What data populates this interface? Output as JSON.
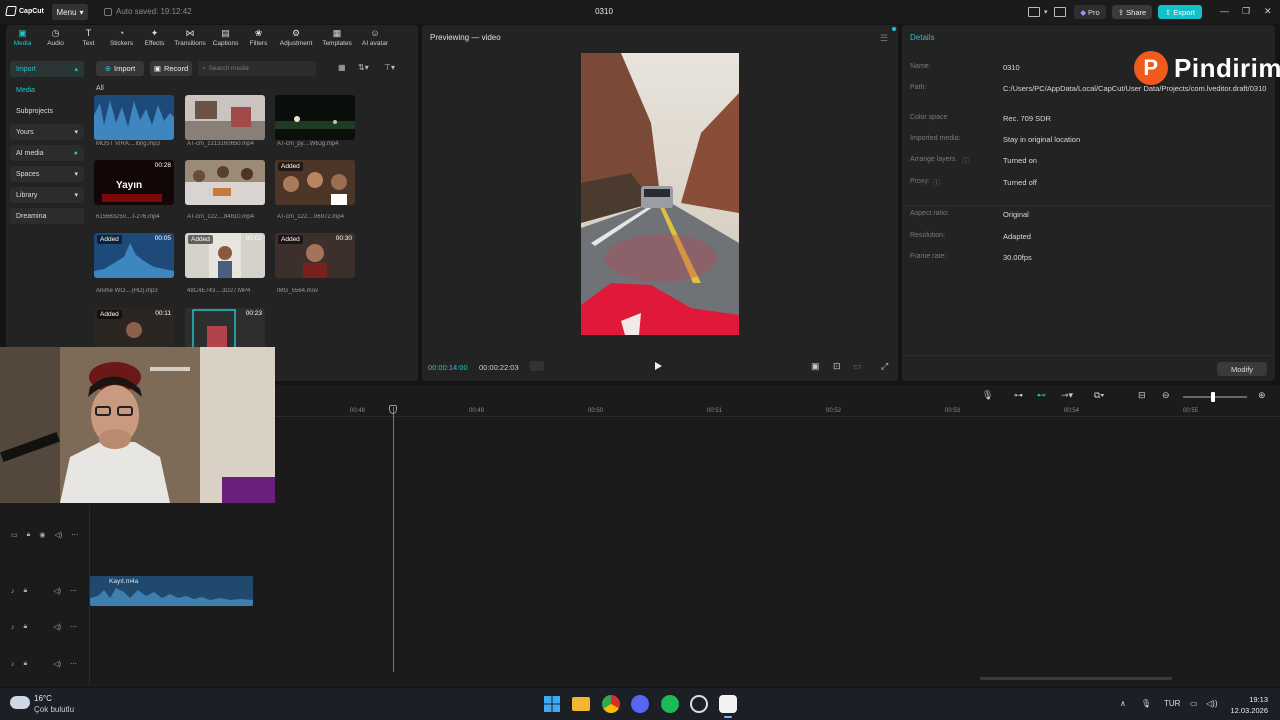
{
  "titlebar": {
    "app_name": "CapCut",
    "menu_label": "Menu",
    "autosave": "Auto saved: 19:12:42",
    "project_title": "0310",
    "pro_label": "Pro",
    "share_label": "Share",
    "export_label": "Export"
  },
  "toolbar": {
    "items": [
      {
        "label": "Media",
        "icon": "media-icon"
      },
      {
        "label": "Audio",
        "icon": "audio-icon"
      },
      {
        "label": "Text",
        "icon": "text-icon"
      },
      {
        "label": "Stickers",
        "icon": "stickers-icon"
      },
      {
        "label": "Effects",
        "icon": "effects-icon"
      },
      {
        "label": "Transitions",
        "icon": "transitions-icon"
      },
      {
        "label": "Captions",
        "icon": "captions-icon"
      },
      {
        "label": "Filters",
        "icon": "filters-icon"
      },
      {
        "label": "Adjustment",
        "icon": "adjustment-icon"
      },
      {
        "label": "Templates",
        "icon": "templates-icon"
      },
      {
        "label": "AI avatar",
        "icon": "ai-avatar-icon"
      }
    ]
  },
  "sidebar": {
    "items": [
      {
        "label": "Import"
      },
      {
        "label": "Media"
      },
      {
        "label": "Subprojects"
      },
      {
        "label": "Yours"
      },
      {
        "label": "AI media"
      },
      {
        "label": "Spaces"
      },
      {
        "label": "Library"
      },
      {
        "label": "Dreamina"
      }
    ]
  },
  "media": {
    "import_label": "Import",
    "record_label": "Record",
    "search_placeholder": "Search media",
    "filter_all": "All",
    "items": [
      {
        "name": "MOST VIRA....iting.mp3",
        "badge": "",
        "duration": ""
      },
      {
        "name": "AT-cm_1213160650.mp4",
        "badge": "",
        "duration": ""
      },
      {
        "name": "AT-cm_py....W6Jg.mp4",
        "badge": "",
        "duration": ""
      },
      {
        "name": "615663250....t-276.mp4",
        "badge": "",
        "duration": "00:28"
      },
      {
        "name": "AT-cm_122....84610.mp4",
        "badge": "",
        "duration": ""
      },
      {
        "name": "AT-cm_122....06972.mp4",
        "badge": "Added",
        "duration": ""
      },
      {
        "name": "Anime WO....(HD).mp3",
        "badge": "Added",
        "duration": "00:05"
      },
      {
        "name": "48C4E743....3D27.MP4",
        "badge": "Added",
        "duration": "00:02"
      },
      {
        "name": "IMG_5564.mov",
        "badge": "Added",
        "duration": "00:30"
      },
      {
        "name": "",
        "badge": "Added",
        "duration": "00:11"
      },
      {
        "name": "",
        "badge": "",
        "duration": "00:23"
      }
    ],
    "thumb_text": "Yayın"
  },
  "preview": {
    "title": "Previewing — video",
    "current_time": "00:00:14:00",
    "total_time": "00:00:22:03"
  },
  "details": {
    "title": "Details",
    "rows": [
      {
        "label": "Name:",
        "value": "0310"
      },
      {
        "label": "Path:",
        "value": "C:/Users/PC/AppData/Local/CapCut/User Data/Projects/com.lveditor.draft/0310"
      },
      {
        "label": "Color space",
        "value": "Rec. 709 SDR"
      },
      {
        "label": "Imported media:",
        "value": "Stay in original location"
      },
      {
        "label": "Arrange layers",
        "value": "Turned on"
      },
      {
        "label": "Proxy:",
        "value": "Turned off"
      },
      {
        "label": "Aspect ratio:",
        "value": "Original"
      },
      {
        "label": "Resolution:",
        "value": "Adapted"
      },
      {
        "label": "Frame rate:",
        "value": "30.00fps"
      }
    ],
    "modify_label": "Modify"
  },
  "brand_overlay": "Pindirim",
  "timeline": {
    "ruler": [
      "00:48",
      "00:49",
      "00:50",
      "00:51",
      "00:52",
      "00:53",
      "00:54",
      "00:55"
    ],
    "audio_clip_name": "Kayıt.m4a"
  },
  "taskbar": {
    "temperature": "16°C",
    "weather": "Çok bulutlu",
    "language": "TUR",
    "time": "19:13",
    "date": "12.03.2026"
  },
  "colors": {
    "accent": "#13c0c7",
    "brand": "#f05a1a",
    "audio_clip": "#1f4a6e"
  }
}
